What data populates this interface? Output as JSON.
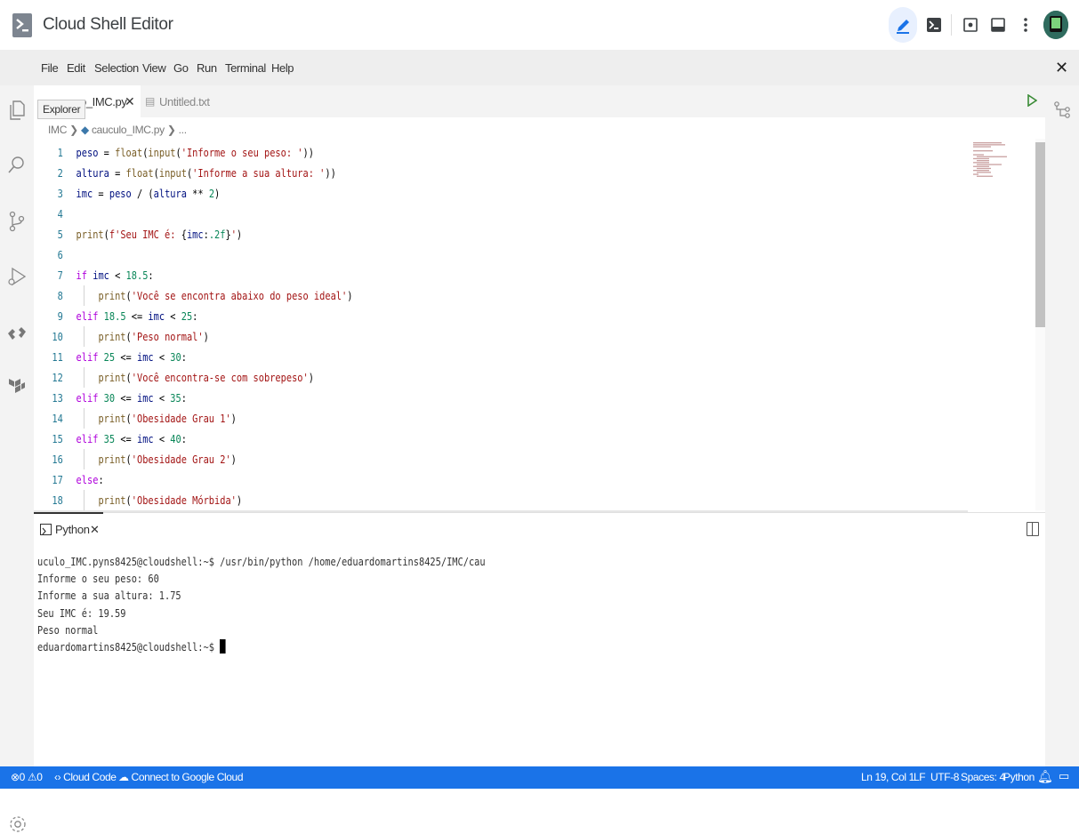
{
  "app": {
    "title": "Cloud Shell Editor"
  },
  "menu": [
    "File",
    "Edit",
    "Selection",
    "View",
    "Go",
    "Run",
    "Terminal",
    "Help"
  ],
  "tabs": [
    {
      "label": "o_IMC.py",
      "active": true
    },
    {
      "label": "Untitled.txt",
      "active": false
    }
  ],
  "tooltip": "Explorer",
  "breadcrumb": {
    "folder": "IMC",
    "file": "cauculo_IMC.py",
    "more": "..."
  },
  "code": [
    {
      "n": "1",
      "tokens": [
        [
          "id",
          "peso"
        ],
        [
          "plain",
          " = "
        ],
        [
          "fn",
          "float"
        ],
        [
          "plain",
          "("
        ],
        [
          "fn",
          "input"
        ],
        [
          "plain",
          "("
        ],
        [
          "str",
          "'Informe o seu peso: '"
        ],
        [
          "plain",
          "))"
        ]
      ]
    },
    {
      "n": "2",
      "tokens": [
        [
          "id",
          "altura"
        ],
        [
          "plain",
          " = "
        ],
        [
          "fn",
          "float"
        ],
        [
          "plain",
          "("
        ],
        [
          "fn",
          "input"
        ],
        [
          "plain",
          "("
        ],
        [
          "str",
          "'Informe a sua altura: '"
        ],
        [
          "plain",
          "))"
        ]
      ]
    },
    {
      "n": "3",
      "tokens": [
        [
          "id",
          "imc"
        ],
        [
          "plain",
          " = "
        ],
        [
          "id",
          "peso"
        ],
        [
          "plain",
          " / ("
        ],
        [
          "id",
          "altura"
        ],
        [
          "plain",
          " ** "
        ],
        [
          "num",
          "2"
        ],
        [
          "plain",
          ")"
        ]
      ]
    },
    {
      "n": "4",
      "tokens": []
    },
    {
      "n": "5",
      "tokens": [
        [
          "fn",
          "print"
        ],
        [
          "plain",
          "("
        ],
        [
          "str",
          "f'Seu IMC é: "
        ],
        [
          "plain",
          "{"
        ],
        [
          "id",
          "imc"
        ],
        [
          "plain",
          ":"
        ],
        [
          "num",
          ".2f"
        ],
        [
          "plain",
          "}"
        ],
        [
          "str",
          "'"
        ],
        [
          "plain",
          ")"
        ]
      ]
    },
    {
      "n": "6",
      "tokens": []
    },
    {
      "n": "7",
      "tokens": [
        [
          "kw",
          "if"
        ],
        [
          "plain",
          " "
        ],
        [
          "id",
          "imc"
        ],
        [
          "plain",
          " < "
        ],
        [
          "num",
          "18.5"
        ],
        [
          "plain",
          ":"
        ]
      ]
    },
    {
      "n": "8",
      "tokens": [
        [
          "plain",
          "    "
        ],
        [
          "fn",
          "print"
        ],
        [
          "plain",
          "("
        ],
        [
          "str",
          "'Você se encontra abaixo do peso ideal'"
        ],
        [
          "plain",
          ")"
        ]
      ]
    },
    {
      "n": "9",
      "tokens": [
        [
          "kw",
          "elif"
        ],
        [
          "plain",
          " "
        ],
        [
          "num",
          "18.5"
        ],
        [
          "plain",
          " <= "
        ],
        [
          "id",
          "imc"
        ],
        [
          "plain",
          " < "
        ],
        [
          "num",
          "25"
        ],
        [
          "plain",
          ":"
        ]
      ]
    },
    {
      "n": "10",
      "tokens": [
        [
          "plain",
          "    "
        ],
        [
          "fn",
          "print"
        ],
        [
          "plain",
          "("
        ],
        [
          "str",
          "'Peso normal'"
        ],
        [
          "plain",
          ")"
        ]
      ]
    },
    {
      "n": "11",
      "tokens": [
        [
          "kw",
          "elif"
        ],
        [
          "plain",
          " "
        ],
        [
          "num",
          "25"
        ],
        [
          "plain",
          " <= "
        ],
        [
          "id",
          "imc"
        ],
        [
          "plain",
          " < "
        ],
        [
          "num",
          "30"
        ],
        [
          "plain",
          ":"
        ]
      ]
    },
    {
      "n": "12",
      "tokens": [
        [
          "plain",
          "    "
        ],
        [
          "fn",
          "print"
        ],
        [
          "plain",
          "("
        ],
        [
          "str",
          "'Você encontra-se com sobrepeso'"
        ],
        [
          "plain",
          ")"
        ]
      ]
    },
    {
      "n": "13",
      "tokens": [
        [
          "kw",
          "elif"
        ],
        [
          "plain",
          " "
        ],
        [
          "num",
          "30"
        ],
        [
          "plain",
          " <= "
        ],
        [
          "id",
          "imc"
        ],
        [
          "plain",
          " < "
        ],
        [
          "num",
          "35"
        ],
        [
          "plain",
          ":"
        ]
      ]
    },
    {
      "n": "14",
      "tokens": [
        [
          "plain",
          "    "
        ],
        [
          "fn",
          "print"
        ],
        [
          "plain",
          "("
        ],
        [
          "str",
          "'Obesidade Grau 1'"
        ],
        [
          "plain",
          ")"
        ]
      ]
    },
    {
      "n": "15",
      "tokens": [
        [
          "kw",
          "elif"
        ],
        [
          "plain",
          " "
        ],
        [
          "num",
          "35"
        ],
        [
          "plain",
          " <= "
        ],
        [
          "id",
          "imc"
        ],
        [
          "plain",
          " < "
        ],
        [
          "num",
          "40"
        ],
        [
          "plain",
          ":"
        ]
      ]
    },
    {
      "n": "16",
      "tokens": [
        [
          "plain",
          "    "
        ],
        [
          "fn",
          "print"
        ],
        [
          "plain",
          "("
        ],
        [
          "str",
          "'Obesidade Grau 2'"
        ],
        [
          "plain",
          ")"
        ]
      ]
    },
    {
      "n": "17",
      "tokens": [
        [
          "kw",
          "else"
        ],
        [
          "plain",
          ":"
        ]
      ]
    },
    {
      "n": "18",
      "tokens": [
        [
          "plain",
          "    "
        ],
        [
          "fn",
          "print"
        ],
        [
          "plain",
          "("
        ],
        [
          "str",
          "'Obesidade Mórbida'"
        ],
        [
          "plain",
          ")"
        ]
      ]
    }
  ],
  "panel": {
    "tab_label": "Python"
  },
  "terminal": {
    "lines": [
      "uculo_IMC.pyns8425@cloudshell:~$ /usr/bin/python /home/eduardomartins8425/IMC/cau",
      "Informe o seu peso: 60",
      "Informe a sua altura: 1.75",
      "Seu IMC é: 19.59",
      "Peso normal"
    ],
    "prompt": "eduardomartins8425@cloudshell:~$ "
  },
  "statusbar": {
    "errors": "0",
    "warnings": "0",
    "cloud_code": "Cloud Code",
    "connect": "Connect to Google Cloud",
    "position": "Ln 19, Col 1",
    "eol": "LF",
    "encoding": "UTF-8",
    "spaces": "Spaces: 4",
    "language": "Python"
  },
  "colors": {
    "statusbar": "#1a73e8",
    "accent": "#1a73e8",
    "menubar": "#eeeeee"
  },
  "icons": [
    "cloud-shell-logo-icon",
    "pencil-icon",
    "terminal-icon",
    "preview-icon",
    "layout-icon",
    "more-vert-icon",
    "files-icon",
    "search-icon",
    "source-control-icon",
    "run-debug-icon",
    "cloud-code-icon",
    "terraform-icon",
    "settings-icon",
    "play-icon",
    "outline-icon",
    "bell-icon",
    "split-icon"
  ]
}
